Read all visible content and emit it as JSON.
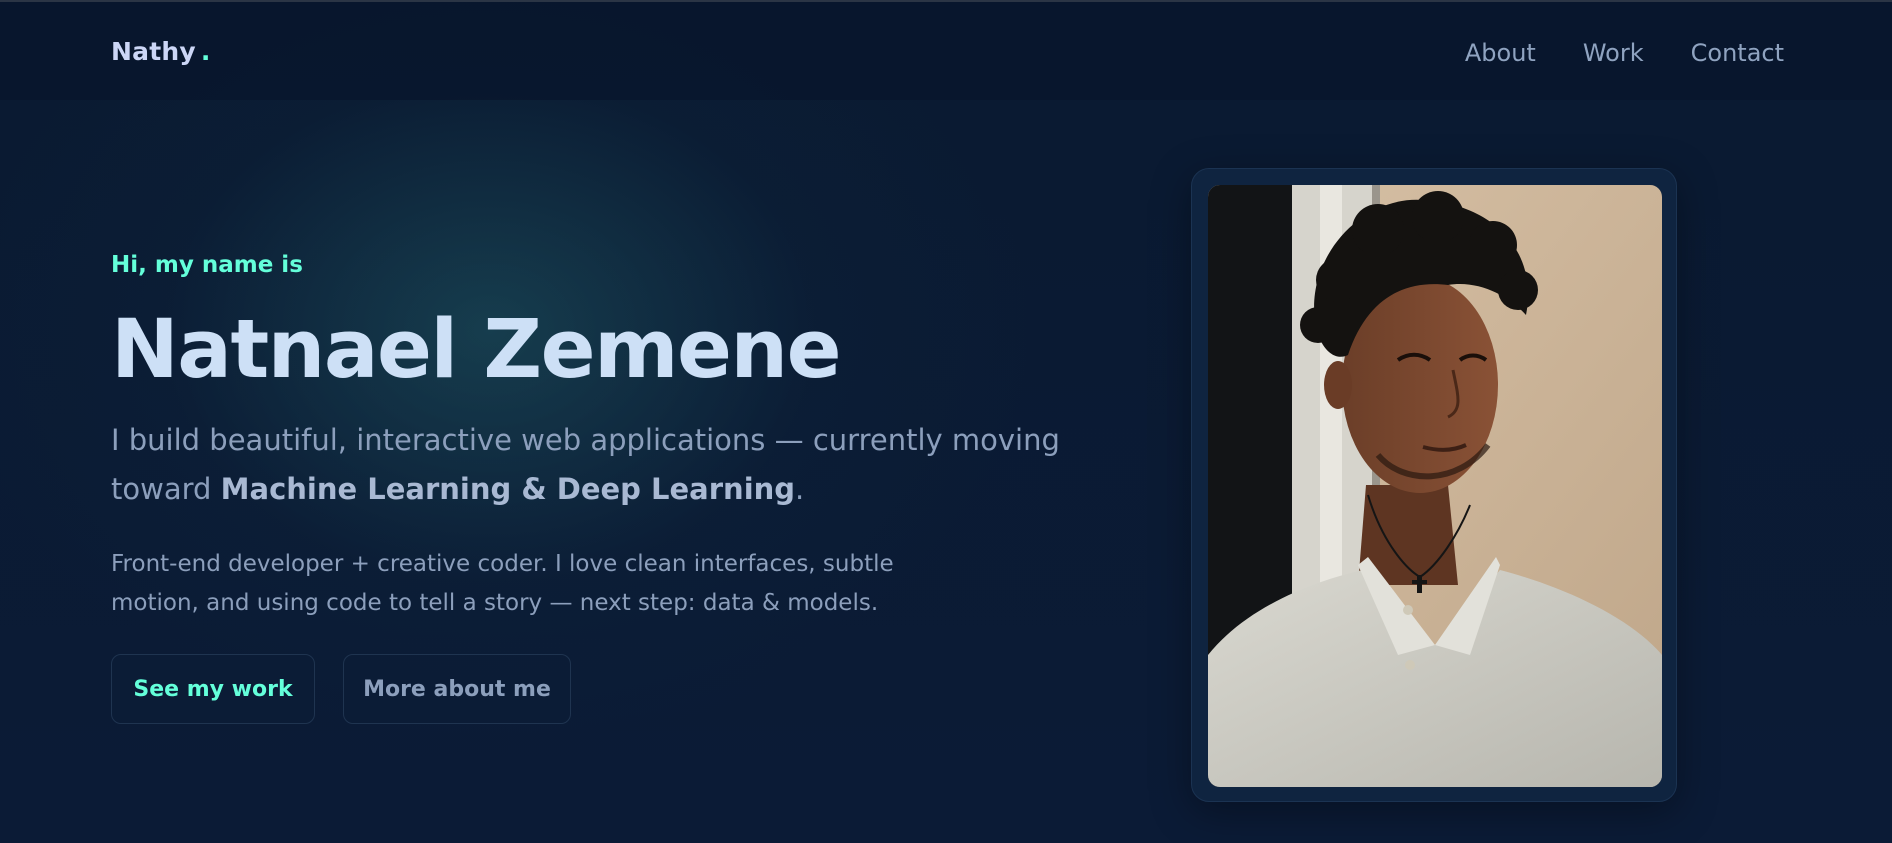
{
  "nav": {
    "logo": "Nathy",
    "logo_dot": ".",
    "links": [
      "About",
      "Work",
      "Contact"
    ]
  },
  "hero": {
    "greeting": "Hi, my name is",
    "name": "Natnael Zemene",
    "tagline_prefix": "I build beautiful, interactive web applications — currently moving toward",
    "tagline_bold": "Machine Learning & Deep Learning",
    "tagline_suffix": ".",
    "description": "Front-end developer + creative coder. I love clean interfaces, subtle motion, and using code to tell a story — next step: data & models.",
    "primary_button": "See my work",
    "secondary_button": "More about me"
  },
  "colors": {
    "accent": "#64ffda",
    "background": "#0a1930",
    "heading": "#cde0f6",
    "text": "#8c9fbc"
  }
}
